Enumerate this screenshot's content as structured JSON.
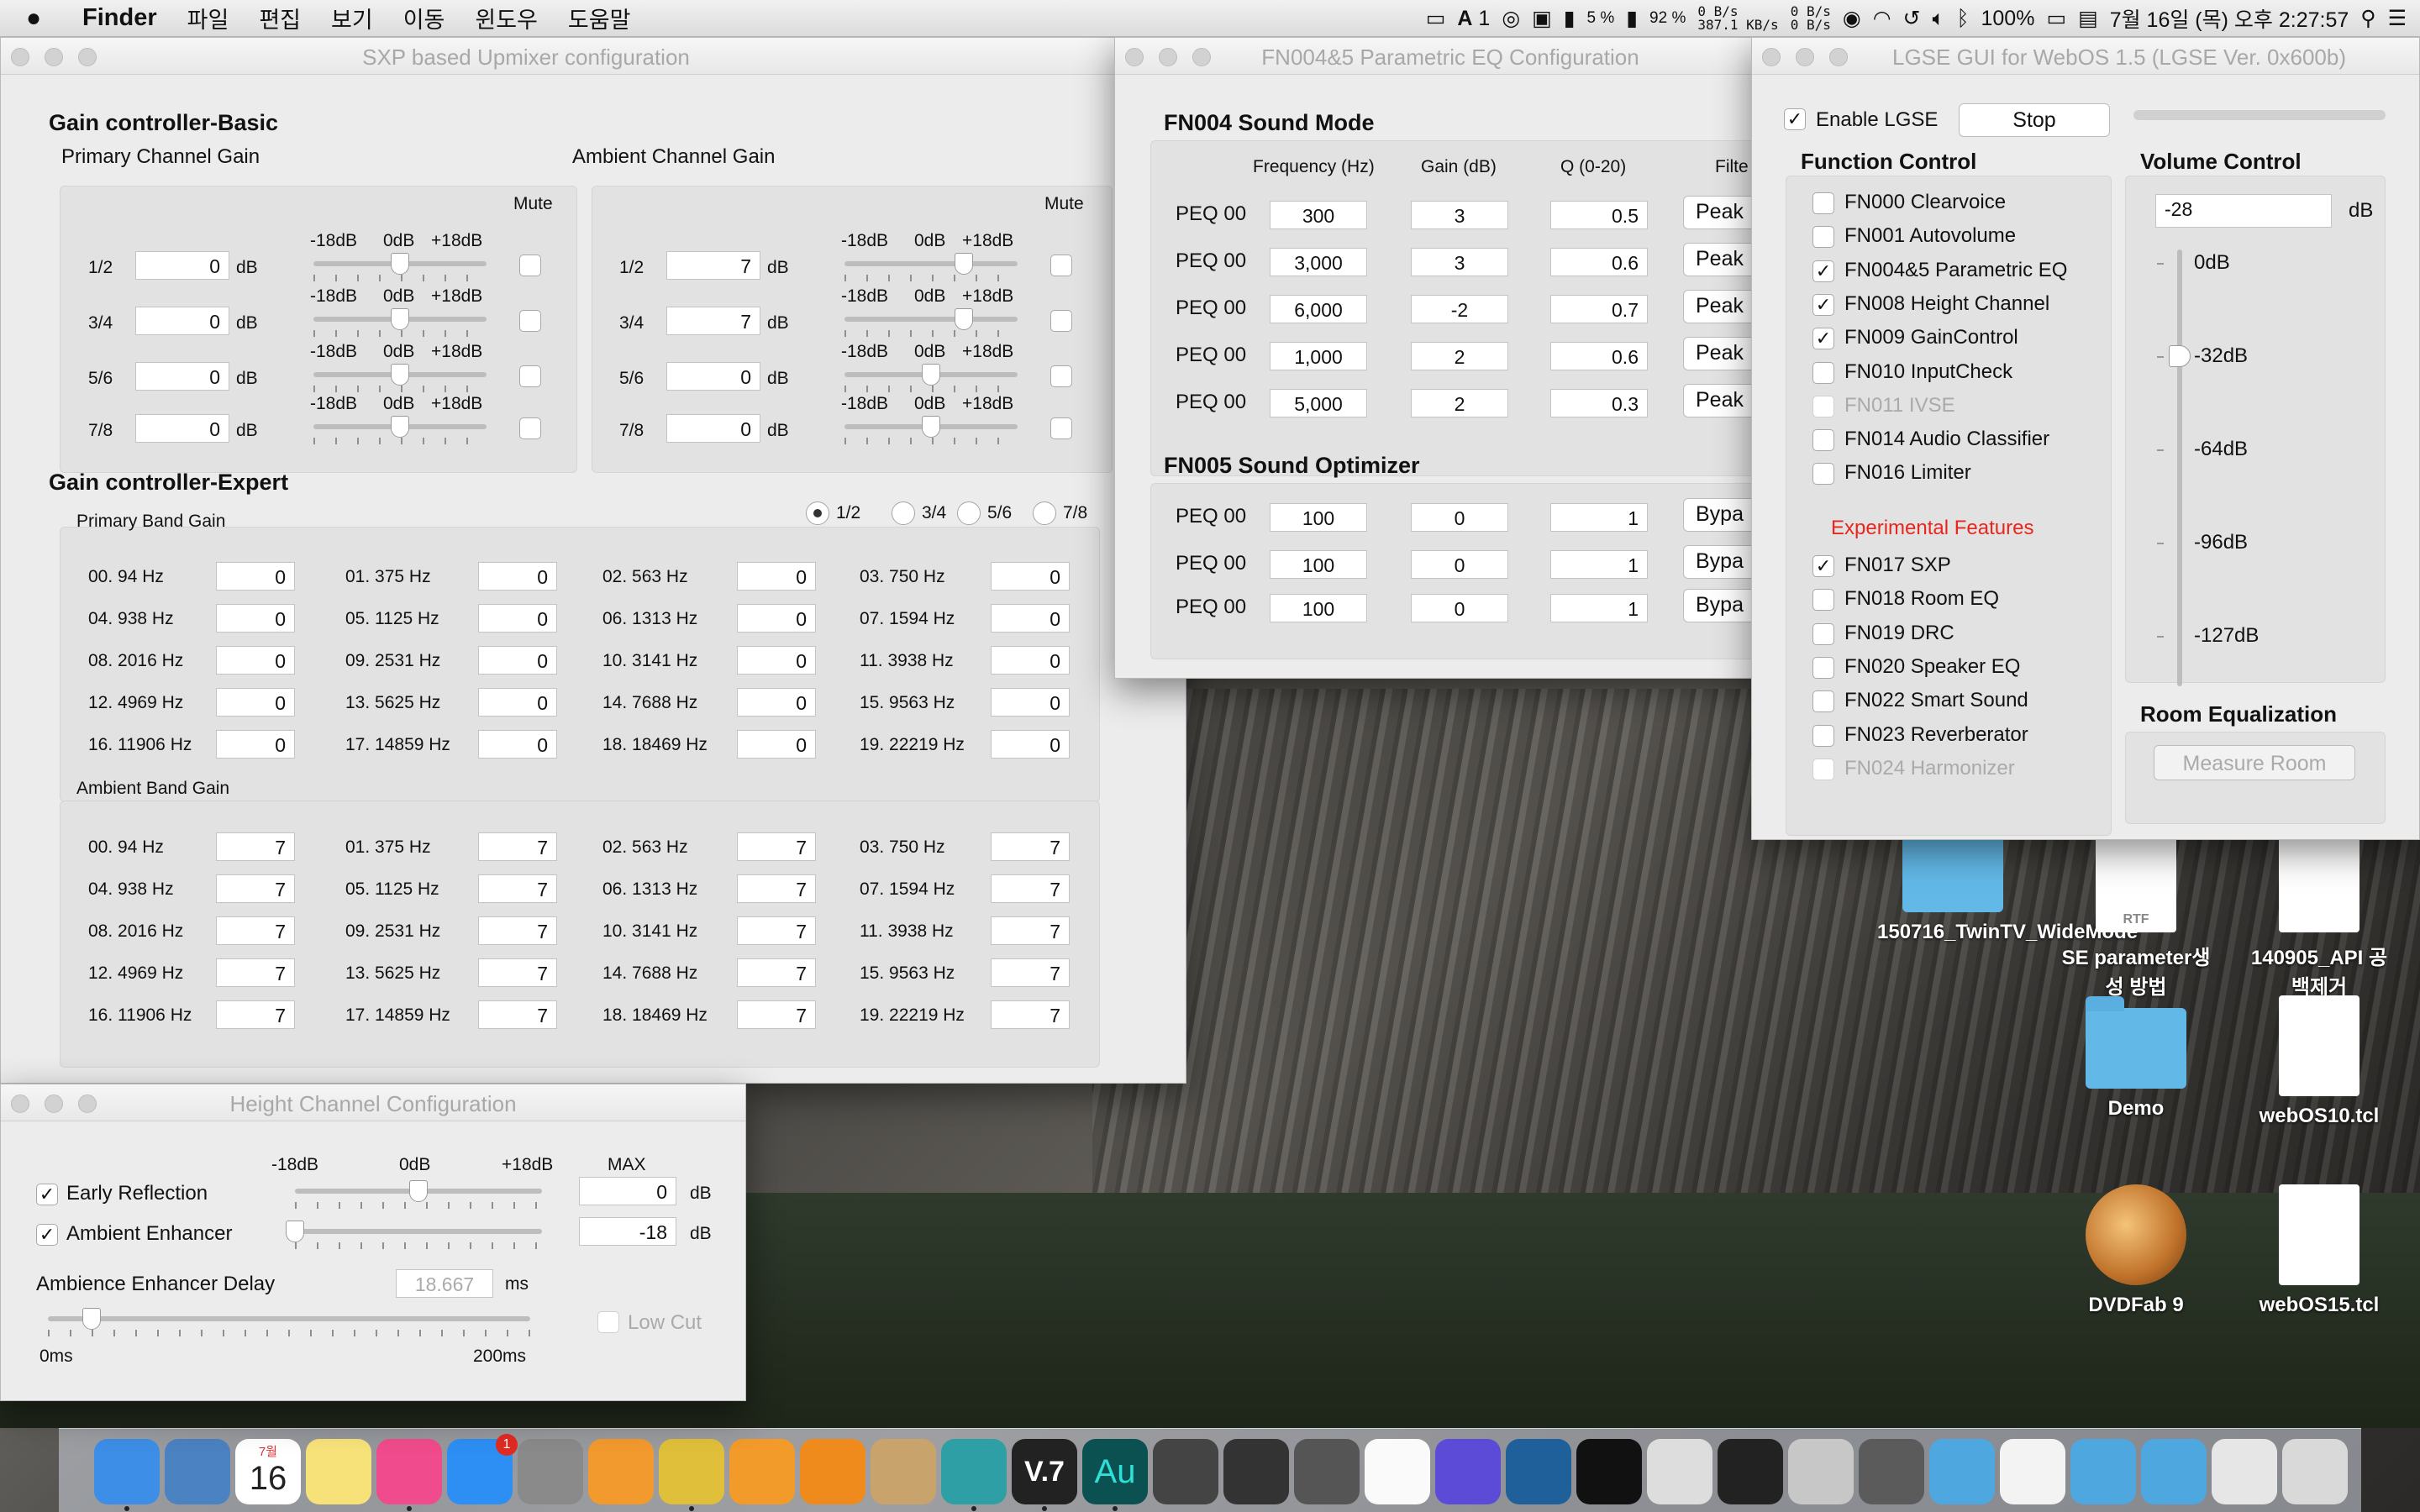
{
  "menubar": {
    "apple": "",
    "app": "Finder",
    "items": [
      "파일",
      "편집",
      "보기",
      "이동",
      "윈도우",
      "도움말"
    ],
    "status": {
      "cpu": "5 %",
      "ram": "92 %",
      "disk_read": "0 B/s",
      "disk_write": "387.1 KB/s",
      "net_in": "0 B/s",
      "net_out": "0 B/s",
      "adobe_count": "1",
      "battery": "100%",
      "datetime": "7월 16일 (목) 오후 2:27:57",
      "input_label": "A"
    }
  },
  "sxp": {
    "title": "SXP based Upmixer configuration",
    "basic_heading": "Gain controller-Basic",
    "primary_heading": "Primary Channel Gain",
    "ambient_heading": "Ambient Channel Gain",
    "mute_label": "Mute",
    "db_unit": "dB",
    "scale": [
      "-18dB",
      "0dB",
      "+18dB"
    ],
    "primary": [
      {
        "ch": "1/2",
        "value": "0",
        "level": 0.5
      },
      {
        "ch": "3/4",
        "value": "0",
        "level": 0.5
      },
      {
        "ch": "5/6",
        "value": "0",
        "level": 0.5
      },
      {
        "ch": "7/8",
        "value": "0",
        "level": 0.5
      }
    ],
    "ambient": [
      {
        "ch": "1/2",
        "value": "7",
        "level": 0.69
      },
      {
        "ch": "3/4",
        "value": "7",
        "level": 0.69
      },
      {
        "ch": "5/6",
        "value": "0",
        "level": 0.5
      },
      {
        "ch": "7/8",
        "value": "0",
        "level": 0.5
      }
    ],
    "expert_heading": "Gain controller-Expert",
    "primary_band_heading": "Primary Band Gain",
    "ambient_band_heading": "Ambient Band Gain",
    "radios": [
      "1/2",
      "3/4",
      "5/6",
      "7/8"
    ],
    "radio_selected": "1/2",
    "bands": [
      "00. 94 Hz",
      "01. 375 Hz",
      "02. 563 Hz",
      "03. 750 Hz",
      "04. 938 Hz",
      "05. 1125 Hz",
      "06. 1313 Hz",
      "07. 1594 Hz",
      "08. 2016 Hz",
      "09. 2531 Hz",
      "10. 3141 Hz",
      "11. 3938 Hz",
      "12. 4969 Hz",
      "13. 5625 Hz",
      "14. 7688 Hz",
      "15. 9563 Hz",
      "16. 11906 Hz",
      "17. 14859 Hz",
      "18. 18469 Hz",
      "19. 22219 Hz"
    ],
    "primary_band_values": [
      "0",
      "0",
      "0",
      "0",
      "0",
      "0",
      "0",
      "0",
      "0",
      "0",
      "0",
      "0",
      "0",
      "0",
      "0",
      "0",
      "0",
      "0",
      "0",
      "0"
    ],
    "ambient_band_values": [
      "7",
      "7",
      "7",
      "7",
      "7",
      "7",
      "7",
      "7",
      "7",
      "7",
      "7",
      "7",
      "7",
      "7",
      "7",
      "7",
      "7",
      "7",
      "7",
      "7"
    ]
  },
  "peq": {
    "title": "FN004&5 Parametric EQ Configuration",
    "mode_heading": "FN004 Sound Mode",
    "col_freq": "Frequency (Hz)",
    "col_gain": "Gain (dB)",
    "col_q": "Q (0-20)",
    "col_filter": "Filte",
    "mode_rows": [
      {
        "label": "PEQ 00",
        "freq": "300",
        "gain": "3",
        "q": "0.5",
        "filter": "Peak"
      },
      {
        "label": "PEQ 00",
        "freq": "3,000",
        "gain": "3",
        "q": "0.6",
        "filter": "Peak"
      },
      {
        "label": "PEQ 00",
        "freq": "6,000",
        "gain": "-2",
        "q": "0.7",
        "filter": "Peak"
      },
      {
        "label": "PEQ 00",
        "freq": "1,000",
        "gain": "2",
        "q": "0.6",
        "filter": "Peak"
      },
      {
        "label": "PEQ 00",
        "freq": "5,000",
        "gain": "2",
        "q": "0.3",
        "filter": "Peak"
      }
    ],
    "opt_heading": "FN005 Sound Optimizer",
    "opt_rows": [
      {
        "label": "PEQ 00",
        "freq": "100",
        "gain": "0",
        "q": "1",
        "filter": "Bypa"
      },
      {
        "label": "PEQ 00",
        "freq": "100",
        "gain": "0",
        "q": "1",
        "filter": "Bypa"
      },
      {
        "label": "PEQ 00",
        "freq": "100",
        "gain": "0",
        "q": "1",
        "filter": "Bypa"
      }
    ]
  },
  "lgse": {
    "title": "LGSE GUI for WebOS 1.5 (LGSE Ver. 0x600b)",
    "enable_label": "Enable LGSE",
    "stop_label": "Stop",
    "function_heading": "Function Control",
    "functions": [
      {
        "label": "FN000 Clearvoice",
        "checked": false,
        "disabled": false
      },
      {
        "label": "FN001 Autovolume",
        "checked": false,
        "disabled": false
      },
      {
        "label": "FN004&5 Parametric EQ",
        "checked": true,
        "disabled": false
      },
      {
        "label": "FN008 Height Channel",
        "checked": true,
        "disabled": false
      },
      {
        "label": "FN009 GainControl",
        "checked": true,
        "disabled": false
      },
      {
        "label": "FN010 InputCheck",
        "checked": false,
        "disabled": false
      },
      {
        "label": "FN011 IVSE",
        "checked": false,
        "disabled": true
      },
      {
        "label": "FN014 Audio Classifier",
        "checked": false,
        "disabled": false
      },
      {
        "label": "FN016 Limiter",
        "checked": false,
        "disabled": false
      }
    ],
    "experimental_heading": "Experimental Features",
    "experimental": [
      {
        "label": "FN017 SXP",
        "checked": true,
        "disabled": false
      },
      {
        "label": "FN018 Room EQ",
        "checked": false,
        "disabled": false
      },
      {
        "label": "FN019 DRC",
        "checked": false,
        "disabled": false
      },
      {
        "label": "FN020 Speaker EQ",
        "checked": false,
        "disabled": false
      },
      {
        "label": "FN022 Smart Sound",
        "checked": false,
        "disabled": false
      },
      {
        "label": "FN023 Reverberator",
        "checked": false,
        "disabled": false
      },
      {
        "label": "FN024 Harmonizer",
        "checked": false,
        "disabled": true
      }
    ],
    "volume_heading": "Volume Control",
    "volume_value": "-28",
    "volume_unit": "dB",
    "volume_level": 0.22,
    "volume_scale": [
      "0dB",
      "-32dB",
      "-64dB",
      "-96dB",
      "-127dB"
    ],
    "room_heading": "Room Equalization",
    "measure_label": "Measure Room"
  },
  "height": {
    "title": "Height Channel Configuration",
    "scale": [
      "-18dB",
      "0dB",
      "+18dB"
    ],
    "max_label": "MAX",
    "rows": [
      {
        "label": "Early Reflection",
        "checked": true,
        "value": "0",
        "level": 0.5
      },
      {
        "label": "Ambient Enhancer",
        "checked": true,
        "value": "-18",
        "level": 0.0
      }
    ],
    "db_unit": "dB",
    "delay_label": "Ambience Enhancer Delay",
    "delay_value": "18.667",
    "delay_unit": "ms",
    "delay_level": 0.09,
    "low_cut_label": "Low Cut",
    "min_label": "0ms",
    "max_ms_label": "200ms"
  },
  "desktop": [
    {
      "label": "150716_TwinTV_WideMode",
      "kind": "folder"
    },
    {
      "label": "SE parameter생성 방법",
      "kind": "rtf",
      "badge": "RTF"
    },
    {
      "label": "140905_API 공백제거",
      "kind": "doc"
    },
    {
      "label": "Demo",
      "kind": "folder"
    },
    {
      "label": "webOS10.tcl",
      "kind": "doc"
    },
    {
      "label": "DVDFab 9",
      "kind": "app"
    },
    {
      "label": "webOS15.tcl",
      "kind": "doc"
    }
  ],
  "dock": {
    "calendar_month": "7월",
    "calendar_day": "16",
    "appstore_badge": "1",
    "v7_label": "V.7",
    "au_label": "Au"
  }
}
